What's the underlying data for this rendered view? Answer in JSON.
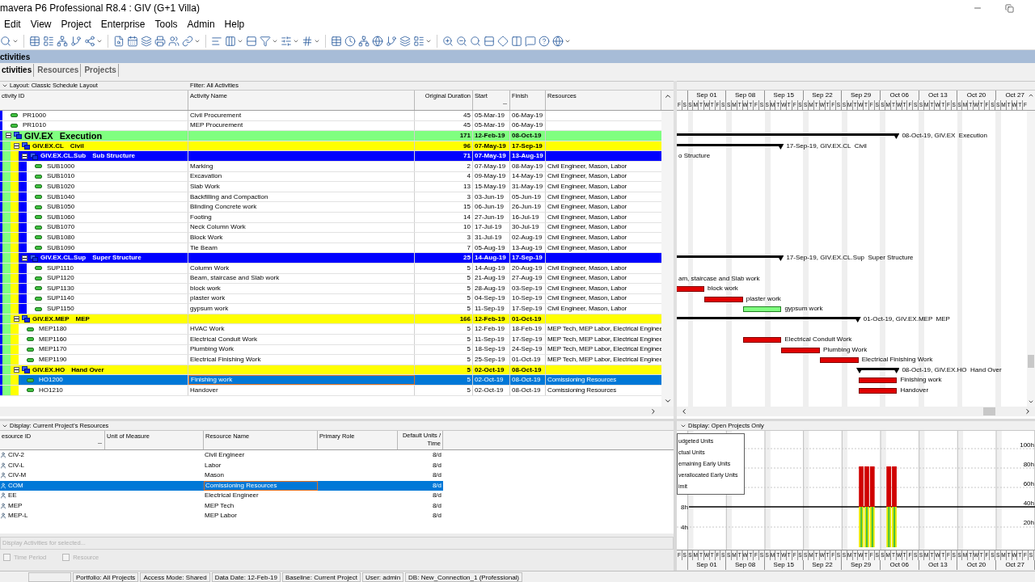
{
  "window": {
    "title": "mavera P6 Professional R8.4 : GIV (G+1 Villa)"
  },
  "menu": [
    "Edit",
    "View",
    "Project",
    "Enterprise",
    "Tools",
    "Admin",
    "Help"
  ],
  "module_title": "ctivities",
  "tabs": [
    {
      "label": "ctivities",
      "selected": true
    },
    {
      "label": "Resources",
      "selected": false
    },
    {
      "label": "Projects",
      "selected": false
    }
  ],
  "activity_table": {
    "layout": "Layout: Classic Schedule Layout",
    "filter": "Filter: All Activities",
    "columns": [
      "ctivity ID",
      "Activity Name",
      "Original Duration",
      "Start",
      "Finish",
      "Resources"
    ],
    "rows": [
      {
        "kind": "activity",
        "id": "PR1000",
        "name": "Civil Procurement",
        "duration": "45",
        "start": "05-Mar-19",
        "finish": "06-May-19",
        "selected": false
      },
      {
        "kind": "activity",
        "id": "PR1010",
        "name": "MEP Procurement",
        "duration": "45",
        "start": "05-Mar-19",
        "finish": "06-May-19",
        "selected": false
      },
      {
        "kind": "wbs",
        "code": "GIV.EX",
        "name": "Execution",
        "duration": "171",
        "start": "12-Feb-19",
        "finish": "08-Oct-19",
        "selected": false,
        "expanded": true,
        "bar": {
          "kind": "summary"
        },
        "gantt_label": "08-Oct-19, GIV.EX  Execution",
        "children": [
          {
            "kind": "wbs",
            "code": "GIV.EX.CL",
            "name": "Civil",
            "duration": "96",
            "start": "07-May-19",
            "finish": "17-Sep-19",
            "selected": false,
            "expanded": true,
            "bar": {
              "kind": "summary"
            },
            "gantt_label": "17-Sep-19, GIV.EX.CL  Civil",
            "children": [
              {
                "kind": "wbs",
                "code": "GIV.EX.CL.Sub",
                "name": "Sub Structure",
                "duration": "71",
                "start": "07-May-19",
                "finish": "13-Aug-19",
                "selected": false,
                "expanded": true,
                "gantt_label": "o Structure",
                "children": [
                  {
                    "kind": "activity",
                    "id": "SUB1000",
                    "name": "Marking",
                    "duration": "2",
                    "start": "07-May-19",
                    "finish": "08-May-19",
                    "resources": "Civil Engineer, Mason, Labor",
                    "selected": false
                  },
                  {
                    "kind": "activity",
                    "id": "SUB1010",
                    "name": "Excavation",
                    "duration": "4",
                    "start": "09-May-19",
                    "finish": "14-May-19",
                    "resources": "Civil Engineer, Mason, Labor",
                    "selected": false
                  },
                  {
                    "kind": "activity",
                    "id": "SUB1020",
                    "name": "Slab Work",
                    "duration": "13",
                    "start": "15-May-19",
                    "finish": "31-May-19",
                    "resources": "Civil Engineer, Mason, Labor",
                    "selected": false
                  },
                  {
                    "kind": "activity",
                    "id": "SUB1040",
                    "name": "Backfilling and Compaction",
                    "duration": "3",
                    "start": "03-Jun-19",
                    "finish": "05-Jun-19",
                    "resources": "Civil Engineer, Mason, Labor",
                    "selected": false
                  },
                  {
                    "kind": "activity",
                    "id": "SUB1050",
                    "name": "Blinding Concrete work",
                    "duration": "15",
                    "start": "06-Jun-19",
                    "finish": "26-Jun-19",
                    "resources": "Civil Engineer, Mason, Labor",
                    "selected": false
                  },
                  {
                    "kind": "activity",
                    "id": "SUB1060",
                    "name": "Footing",
                    "duration": "14",
                    "start": "27-Jun-19",
                    "finish": "16-Jul-19",
                    "resources": "Civil Engineer, Mason, Labor",
                    "selected": false
                  },
                  {
                    "kind": "activity",
                    "id": "SUB1070",
                    "name": "Neck Column Work",
                    "duration": "10",
                    "start": "17-Jul-19",
                    "finish": "30-Jul-19",
                    "resources": "Civil Engineer, Mason, Labor",
                    "selected": false
                  },
                  {
                    "kind": "activity",
                    "id": "SUB1080",
                    "name": "Block Work",
                    "duration": "3",
                    "start": "31-Jul-19",
                    "finish": "02-Aug-19",
                    "resources": "Civil Engineer, Mason, Labor",
                    "selected": false
                  },
                  {
                    "kind": "activity",
                    "id": "SUB1090",
                    "name": "Tie Beam",
                    "duration": "7",
                    "start": "05-Aug-19",
                    "finish": "13-Aug-19",
                    "resources": "Civil Engineer, Mason, Labor",
                    "selected": false
                  }
                ]
              },
              {
                "kind": "wbs",
                "code": "GIV.EX.CL.Sup",
                "name": "Super Structure",
                "duration": "25",
                "start": "14-Aug-19",
                "finish": "17-Sep-19",
                "selected": false,
                "expanded": true,
                "bar": {
                  "kind": "summary"
                },
                "gantt_label": "17-Sep-19, GIV.EX.CL.Sup  Super Structure",
                "children": [
                  {
                    "kind": "activity",
                    "id": "SUP1110",
                    "name": "Column Work",
                    "duration": "5",
                    "start": "14-Aug-19",
                    "finish": "20-Aug-19",
                    "resources": "Civil Engineer, Mason, Labor",
                    "selected": false
                  },
                  {
                    "kind": "activity",
                    "id": "SUP1120",
                    "name": "Beam, staircase and Slab work",
                    "duration": "5",
                    "start": "21-Aug-19",
                    "finish": "27-Aug-19",
                    "resources": "Civil Engineer, Mason, Labor",
                    "selected": false,
                    "gantt_label": "am, staircase and Slab work"
                  },
                  {
                    "kind": "activity",
                    "id": "SUP1130",
                    "name": "block work",
                    "duration": "5",
                    "start": "28-Aug-19",
                    "finish": "03-Sep-19",
                    "resources": "Civil Engineer, Mason, Labor",
                    "selected": false,
                    "bar": {
                      "kind": "critical"
                    },
                    "gantt_label": "block work"
                  },
                  {
                    "kind": "activity",
                    "id": "SUP1140",
                    "name": "plaster work",
                    "duration": "5",
                    "start": "04-Sep-19",
                    "finish": "10-Sep-19",
                    "resources": "Civil Engineer, Mason, Labor",
                    "selected": false,
                    "bar": {
                      "kind": "critical"
                    },
                    "gantt_label": "plaster work"
                  },
                  {
                    "kind": "activity",
                    "id": "SUP1150",
                    "name": "gypsum work",
                    "duration": "5",
                    "start": "11-Sep-19",
                    "finish": "17-Sep-19",
                    "resources": "Civil Engineer, Mason, Labor",
                    "selected": false,
                    "bar": {
                      "kind": "normal"
                    },
                    "gantt_label": "gypsum work"
                  }
                ]
              }
            ]
          },
          {
            "kind": "wbs",
            "code": "GIV.EX.MEP",
            "name": "MEP",
            "duration": "166",
            "start": "12-Feb-19",
            "finish": "01-Oct-19",
            "selected": false,
            "expanded": true,
            "bar": {
              "kind": "summary"
            },
            "gantt_label": "01-Oct-19, GIV.EX.MEP  MEP",
            "children": [
              {
                "kind": "activity",
                "id": "MEP1180",
                "name": "HVAC Work",
                "duration": "5",
                "start": "12-Feb-19",
                "finish": "18-Feb-19",
                "resources": "MEP Tech, MEP Labor, Electrical Enginee",
                "selected": false
              },
              {
                "kind": "activity",
                "id": "MEP1160",
                "name": "Electrical Conduit Work",
                "duration": "5",
                "start": "11-Sep-19",
                "finish": "17-Sep-19",
                "resources": "MEP Tech, MEP Labor, Electrical Enginee",
                "selected": false,
                "bar": {
                  "kind": "critical"
                },
                "gantt_label": "Electrical Conduit Work"
              },
              {
                "kind": "activity",
                "id": "MEP1170",
                "name": "Plumbing Work",
                "duration": "5",
                "start": "18-Sep-19",
                "finish": "24-Sep-19",
                "resources": "MEP Tech, MEP Labor, Electrical Enginee",
                "selected": false,
                "bar": {
                  "kind": "critical"
                },
                "gantt_label": "Plumbing Work"
              },
              {
                "kind": "activity",
                "id": "MEP1190",
                "name": "Electrical Finishing Work",
                "duration": "5",
                "start": "25-Sep-19",
                "finish": "01-Oct-19",
                "resources": "MEP Tech, MEP Labor, Electrical Enginee",
                "selected": false,
                "bar": {
                  "kind": "critical"
                },
                "gantt_label": "Electrical Finishing Work"
              }
            ]
          },
          {
            "kind": "wbs",
            "code": "GIV.EX.HO",
            "name": "Hand Over",
            "duration": "5",
            "start": "02-Oct-19",
            "finish": "08-Oct-19",
            "selected": false,
            "expanded": true,
            "bar": {
              "kind": "summary"
            },
            "gantt_label": "08-Oct-19, GIV.EX.HO  Hand Over",
            "children": [
              {
                "kind": "activity",
                "id": "HO1200",
                "name": "Finishing work",
                "duration": "5",
                "start": "02-Oct-19",
                "finish": "08-Oct-19",
                "resources": "Comissioning Resources",
                "selected": true,
                "bar": {
                  "kind": "critical"
                },
                "gantt_label": "Finishing work"
              },
              {
                "kind": "activity",
                "id": "HO1210",
                "name": "Handover",
                "duration": "5",
                "start": "02-Oct-19",
                "finish": "08-Oct-19",
                "resources": "Comissioning Resources",
                "selected": false,
                "bar": {
                  "kind": "critical"
                },
                "gantt_label": "Handover"
              }
            ]
          }
        ]
      }
    ]
  },
  "gantt": {
    "weeks": [
      "Sep 01",
      "Sep 08",
      "Sep 15",
      "Sep 22",
      "Sep 29",
      "Oct 06",
      "Oct 13",
      "Oct 20",
      "Oct 27"
    ],
    "days": [
      "F",
      "S",
      "S",
      "M",
      "T",
      "W",
      "T",
      "F",
      "S",
      "S",
      "M",
      "T",
      "W",
      "T",
      "F",
      "S",
      "S",
      "M",
      "T",
      "W",
      "T",
      "F",
      "S",
      "S",
      "M",
      "T",
      "W",
      "T",
      "F",
      "S",
      "S",
      "M",
      "T",
      "W",
      "T",
      "F",
      "S",
      "S",
      "M",
      "T",
      "W",
      "T",
      "F",
      "S",
      "S",
      "M",
      "T",
      "W",
      "T",
      "F",
      "S",
      "S",
      "M",
      "T",
      "W",
      "T",
      "F",
      "S",
      "S",
      "M",
      "T",
      "W",
      "T",
      "F"
    ]
  },
  "resource_table": {
    "display": "Display: Current Project's Resources",
    "columns": [
      "esource ID",
      "Unit of Measure",
      "Resource Name",
      "Primary Role",
      "Default Units / Time"
    ],
    "rows": [
      {
        "id": "CIV-2",
        "name": "Civil Engineer",
        "units": "8/d",
        "selected": false
      },
      {
        "id": "CIV-L",
        "name": "Labor",
        "units": "8/d",
        "selected": false
      },
      {
        "id": "CIV-M",
        "name": "Mason",
        "units": "8/d",
        "selected": false
      },
      {
        "id": "COM",
        "name": "Comissioning Resources",
        "units": "8/d",
        "selected": true
      },
      {
        "id": "EE",
        "name": "Electrical Engineer",
        "units": "8/d",
        "selected": false
      },
      {
        "id": "MEP",
        "name": "MEP Tech",
        "units": "8/d",
        "selected": false
      },
      {
        "id": "MEP-L",
        "name": "MEP Labor",
        "units": "8/d",
        "selected": false
      }
    ],
    "activities_label": {
      "text": "Display Activities for selected...",
      "disabled": true
    },
    "options": [
      {
        "label": "Time Period",
        "checked": false,
        "disabled": true
      },
      {
        "label": "Resource",
        "checked": false,
        "disabled": true
      }
    ]
  },
  "histogram": {
    "display": "Display: Open Projects Only",
    "legend": [
      "udgeted Units",
      "ctual Units",
      "emaining Early Units",
      "verallocated Early Units",
      "imit"
    ],
    "left_axis": [
      "8h",
      "4h"
    ],
    "right_axis": [
      "100h",
      "80h",
      "60h",
      "40h",
      "20h"
    ],
    "weeks": [
      "Sep 01",
      "Sep 08",
      "Sep 15",
      "Sep 22",
      "Sep 29",
      "Oct 06",
      "Oct 13",
      "Oct 20",
      "Oct 27"
    ],
    "days": [
      "F",
      "S",
      "S",
      "M",
      "T",
      "W",
      "T",
      "F",
      "S",
      "S",
      "M",
      "T",
      "W",
      "T",
      "F",
      "S",
      "S",
      "M",
      "T",
      "W",
      "T",
      "F",
      "S",
      "S",
      "M",
      "T",
      "W",
      "T",
      "F",
      "S",
      "S",
      "M",
      "T",
      "W",
      "T",
      "F",
      "S",
      "S",
      "M",
      "T",
      "W",
      "T",
      "F",
      "S",
      "S",
      "M",
      "T",
      "W",
      "T",
      "F",
      "S",
      "S",
      "M",
      "T",
      "W",
      "T",
      "F",
      "S",
      "S",
      "M",
      "T",
      "W",
      "T",
      "F",
      "S"
    ]
  },
  "status_bar": [
    "Portfolio: All Projects",
    "Access Mode: Shared",
    "Data Date: 12-Feb-19",
    "Baseline: Current Project",
    "User: admin",
    "DB: New_Connection_1 (Professional)"
  ]
}
